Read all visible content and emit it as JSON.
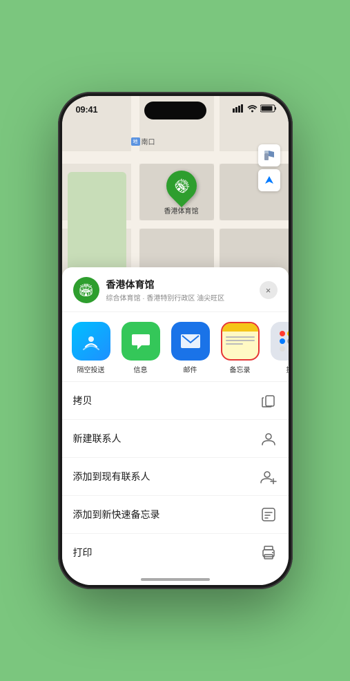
{
  "status_bar": {
    "time": "09:41",
    "signal": "●●●",
    "wifi": "WiFi",
    "battery": "Battery"
  },
  "map": {
    "label_metro": "南口",
    "metro_icon": "地铁",
    "pin_label": "香港体育馆"
  },
  "venue": {
    "name": "香港体育馆",
    "subtitle": "综合体育馆 · 香港特别行政区 油尖旺区",
    "close_label": "×"
  },
  "share_items": [
    {
      "id": "airdrop",
      "label": "隔空投送",
      "icon_type": "airdrop"
    },
    {
      "id": "messages",
      "label": "信息",
      "icon_type": "messages"
    },
    {
      "id": "mail",
      "label": "邮件",
      "icon_type": "mail"
    },
    {
      "id": "notes",
      "label": "备忘录",
      "icon_type": "notes"
    },
    {
      "id": "more",
      "label": "提",
      "icon_type": "more"
    }
  ],
  "actions": [
    {
      "id": "copy",
      "label": "拷贝",
      "icon": "📋"
    },
    {
      "id": "new-contact",
      "label": "新建联系人",
      "icon": "👤"
    },
    {
      "id": "add-existing",
      "label": "添加到现有联系人",
      "icon": "👤+"
    },
    {
      "id": "add-notes",
      "label": "添加到新快速备忘录",
      "icon": "🗒"
    },
    {
      "id": "print",
      "label": "打印",
      "icon": "🖨"
    }
  ]
}
